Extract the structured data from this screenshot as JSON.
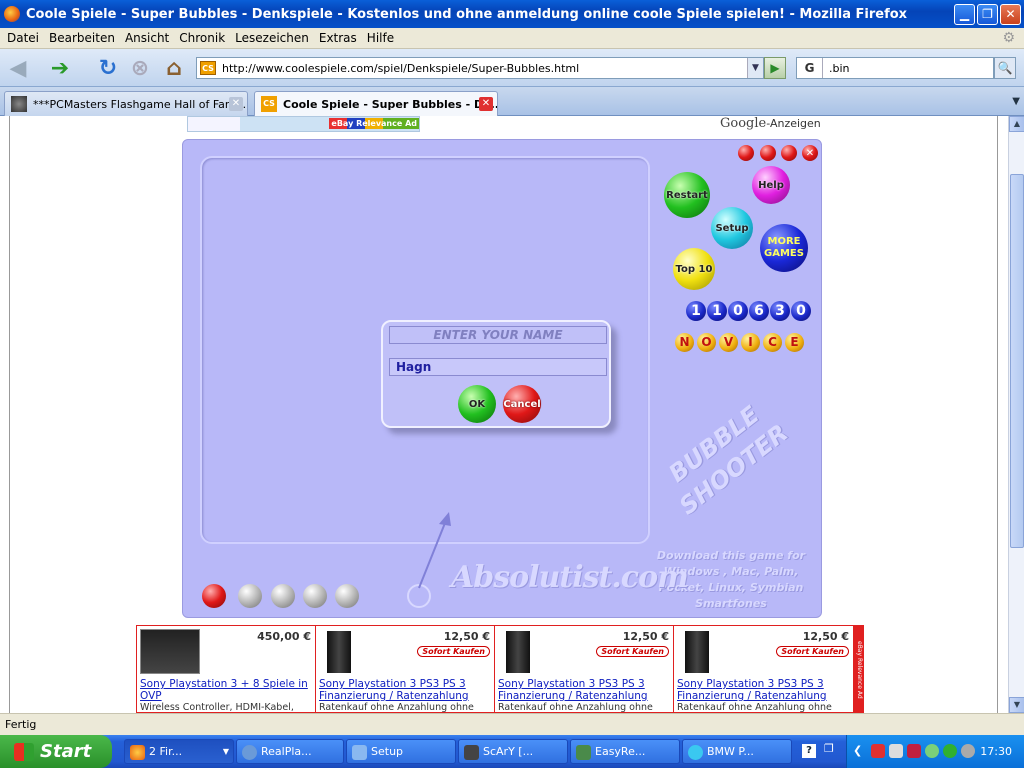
{
  "window": {
    "title": "Coole Spiele - Super Bubbles - Denkspiele - Kostenlos und ohne anmeldung online coole Spiele spielen! - Mozilla Firefox"
  },
  "menu": [
    "Datei",
    "Bearbeiten",
    "Ansicht",
    "Chronik",
    "Lesezeichen",
    "Extras",
    "Hilfe"
  ],
  "nav": {
    "url": "http://www.coolespiele.com/spiel/Denkspiele/Super-Bubbles.html",
    "search_value": ".bin",
    "search_engine": "G"
  },
  "tabs": [
    {
      "label": "***PCMasters Flashgame Hall of Fam..."
    },
    {
      "label": "Coole Spiele - Super Bubbles - De..."
    }
  ],
  "ads": {
    "ebay_label": "eBay Relevance Ad",
    "google_brand": "Google",
    "google_suffix": "-Anzeigen"
  },
  "game": {
    "buttons": {
      "restart": "Restart",
      "help": "Help",
      "setup": "Setup",
      "more_games_1": "MORE",
      "more_games_2": "GAMES",
      "top10": "Top 10"
    },
    "score_digits": [
      "1",
      "1",
      "0",
      "6",
      "3",
      "0"
    ],
    "level_letters": [
      "N",
      "O",
      "V",
      "I",
      "C",
      "E"
    ],
    "dialog": {
      "prompt": "ENTER YOUR NAME",
      "name_value": "Hagn",
      "ok": "OK",
      "cancel": "Cancel"
    },
    "watermark_brand": "Absolutist.com",
    "watermark_title_1": "BUBBLE",
    "watermark_title_2": "SHOOTER",
    "download_text": "Download this game for Windows , Mac, Palm, Pocket, Linux, Symbian Smartfones"
  },
  "products": [
    {
      "price": "450,00 €",
      "title": "Sony Playstation 3 + 8 Spiele in OVP",
      "desc": "Wireless Controller, HDMI-Kabel,",
      "badge": ""
    },
    {
      "price": "12,50 €",
      "title": "Sony Playstation 3 PS3 PS 3 Finanzierung / Ratenzahlung",
      "desc": "Ratenkauf ohne Anzahlung ohne",
      "badge": "Sofort Kaufen"
    },
    {
      "price": "12,50 €",
      "title": "Sony Playstation 3 PS3 PS 3 Finanzierung / Ratenzahlung",
      "desc": "Ratenkauf ohne Anzahlung ohne",
      "badge": "Sofort Kaufen"
    },
    {
      "price": "12,50 €",
      "title": "Sony Playstation 3 PS3 PS 3 Finanzierung / Ratenzahlung",
      "desc": "Ratenkauf ohne Anzahlung ohne",
      "badge": "Sofort Kaufen"
    }
  ],
  "ebay_side": "eBay Relevance Ad",
  "status": "Fertig",
  "taskbar": {
    "start": "Start",
    "tasks": [
      "2 Fir...",
      "RealPla...",
      "Setup",
      "ScArY [...",
      "EasyRe...",
      "BMW P..."
    ],
    "clock": "17:30"
  }
}
